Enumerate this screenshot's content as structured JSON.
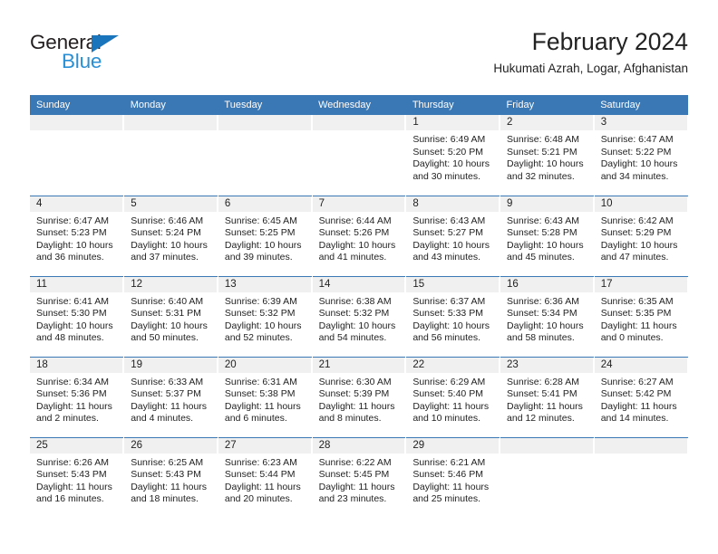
{
  "brand": {
    "name_top": "General",
    "name_bottom": "Blue",
    "triangle_color": "#1b75bc",
    "blue_text_color": "#2a8fd4"
  },
  "header": {
    "title": "February 2024",
    "subtitle": "Hukumati Azrah, Logar, Afghanistan"
  },
  "theme": {
    "header_blue": "#3a77b5",
    "date_band": "#f0f0f0",
    "text": "#222222"
  },
  "weekday_headers": [
    "Sunday",
    "Monday",
    "Tuesday",
    "Wednesday",
    "Thursday",
    "Friday",
    "Saturday"
  ],
  "weeks": [
    [
      {
        "day": "",
        "sunrise": "",
        "sunset": "",
        "daylight": ""
      },
      {
        "day": "",
        "sunrise": "",
        "sunset": "",
        "daylight": ""
      },
      {
        "day": "",
        "sunrise": "",
        "sunset": "",
        "daylight": ""
      },
      {
        "day": "",
        "sunrise": "",
        "sunset": "",
        "daylight": ""
      },
      {
        "day": "1",
        "sunrise": "Sunrise: 6:49 AM",
        "sunset": "Sunset: 5:20 PM",
        "daylight": "Daylight: 10 hours and 30 minutes."
      },
      {
        "day": "2",
        "sunrise": "Sunrise: 6:48 AM",
        "sunset": "Sunset: 5:21 PM",
        "daylight": "Daylight: 10 hours and 32 minutes."
      },
      {
        "day": "3",
        "sunrise": "Sunrise: 6:47 AM",
        "sunset": "Sunset: 5:22 PM",
        "daylight": "Daylight: 10 hours and 34 minutes."
      }
    ],
    [
      {
        "day": "4",
        "sunrise": "Sunrise: 6:47 AM",
        "sunset": "Sunset: 5:23 PM",
        "daylight": "Daylight: 10 hours and 36 minutes."
      },
      {
        "day": "5",
        "sunrise": "Sunrise: 6:46 AM",
        "sunset": "Sunset: 5:24 PM",
        "daylight": "Daylight: 10 hours and 37 minutes."
      },
      {
        "day": "6",
        "sunrise": "Sunrise: 6:45 AM",
        "sunset": "Sunset: 5:25 PM",
        "daylight": "Daylight: 10 hours and 39 minutes."
      },
      {
        "day": "7",
        "sunrise": "Sunrise: 6:44 AM",
        "sunset": "Sunset: 5:26 PM",
        "daylight": "Daylight: 10 hours and 41 minutes."
      },
      {
        "day": "8",
        "sunrise": "Sunrise: 6:43 AM",
        "sunset": "Sunset: 5:27 PM",
        "daylight": "Daylight: 10 hours and 43 minutes."
      },
      {
        "day": "9",
        "sunrise": "Sunrise: 6:43 AM",
        "sunset": "Sunset: 5:28 PM",
        "daylight": "Daylight: 10 hours and 45 minutes."
      },
      {
        "day": "10",
        "sunrise": "Sunrise: 6:42 AM",
        "sunset": "Sunset: 5:29 PM",
        "daylight": "Daylight: 10 hours and 47 minutes."
      }
    ],
    [
      {
        "day": "11",
        "sunrise": "Sunrise: 6:41 AM",
        "sunset": "Sunset: 5:30 PM",
        "daylight": "Daylight: 10 hours and 48 minutes."
      },
      {
        "day": "12",
        "sunrise": "Sunrise: 6:40 AM",
        "sunset": "Sunset: 5:31 PM",
        "daylight": "Daylight: 10 hours and 50 minutes."
      },
      {
        "day": "13",
        "sunrise": "Sunrise: 6:39 AM",
        "sunset": "Sunset: 5:32 PM",
        "daylight": "Daylight: 10 hours and 52 minutes."
      },
      {
        "day": "14",
        "sunrise": "Sunrise: 6:38 AM",
        "sunset": "Sunset: 5:32 PM",
        "daylight": "Daylight: 10 hours and 54 minutes."
      },
      {
        "day": "15",
        "sunrise": "Sunrise: 6:37 AM",
        "sunset": "Sunset: 5:33 PM",
        "daylight": "Daylight: 10 hours and 56 minutes."
      },
      {
        "day": "16",
        "sunrise": "Sunrise: 6:36 AM",
        "sunset": "Sunset: 5:34 PM",
        "daylight": "Daylight: 10 hours and 58 minutes."
      },
      {
        "day": "17",
        "sunrise": "Sunrise: 6:35 AM",
        "sunset": "Sunset: 5:35 PM",
        "daylight": "Daylight: 11 hours and 0 minutes."
      }
    ],
    [
      {
        "day": "18",
        "sunrise": "Sunrise: 6:34 AM",
        "sunset": "Sunset: 5:36 PM",
        "daylight": "Daylight: 11 hours and 2 minutes."
      },
      {
        "day": "19",
        "sunrise": "Sunrise: 6:33 AM",
        "sunset": "Sunset: 5:37 PM",
        "daylight": "Daylight: 11 hours and 4 minutes."
      },
      {
        "day": "20",
        "sunrise": "Sunrise: 6:31 AM",
        "sunset": "Sunset: 5:38 PM",
        "daylight": "Daylight: 11 hours and 6 minutes."
      },
      {
        "day": "21",
        "sunrise": "Sunrise: 6:30 AM",
        "sunset": "Sunset: 5:39 PM",
        "daylight": "Daylight: 11 hours and 8 minutes."
      },
      {
        "day": "22",
        "sunrise": "Sunrise: 6:29 AM",
        "sunset": "Sunset: 5:40 PM",
        "daylight": "Daylight: 11 hours and 10 minutes."
      },
      {
        "day": "23",
        "sunrise": "Sunrise: 6:28 AM",
        "sunset": "Sunset: 5:41 PM",
        "daylight": "Daylight: 11 hours and 12 minutes."
      },
      {
        "day": "24",
        "sunrise": "Sunrise: 6:27 AM",
        "sunset": "Sunset: 5:42 PM",
        "daylight": "Daylight: 11 hours and 14 minutes."
      }
    ],
    [
      {
        "day": "25",
        "sunrise": "Sunrise: 6:26 AM",
        "sunset": "Sunset: 5:43 PM",
        "daylight": "Daylight: 11 hours and 16 minutes."
      },
      {
        "day": "26",
        "sunrise": "Sunrise: 6:25 AM",
        "sunset": "Sunset: 5:43 PM",
        "daylight": "Daylight: 11 hours and 18 minutes."
      },
      {
        "day": "27",
        "sunrise": "Sunrise: 6:23 AM",
        "sunset": "Sunset: 5:44 PM",
        "daylight": "Daylight: 11 hours and 20 minutes."
      },
      {
        "day": "28",
        "sunrise": "Sunrise: 6:22 AM",
        "sunset": "Sunset: 5:45 PM",
        "daylight": "Daylight: 11 hours and 23 minutes."
      },
      {
        "day": "29",
        "sunrise": "Sunrise: 6:21 AM",
        "sunset": "Sunset: 5:46 PM",
        "daylight": "Daylight: 11 hours and 25 minutes."
      },
      {
        "day": "",
        "sunrise": "",
        "sunset": "",
        "daylight": ""
      },
      {
        "day": "",
        "sunrise": "",
        "sunset": "",
        "daylight": ""
      }
    ]
  ]
}
